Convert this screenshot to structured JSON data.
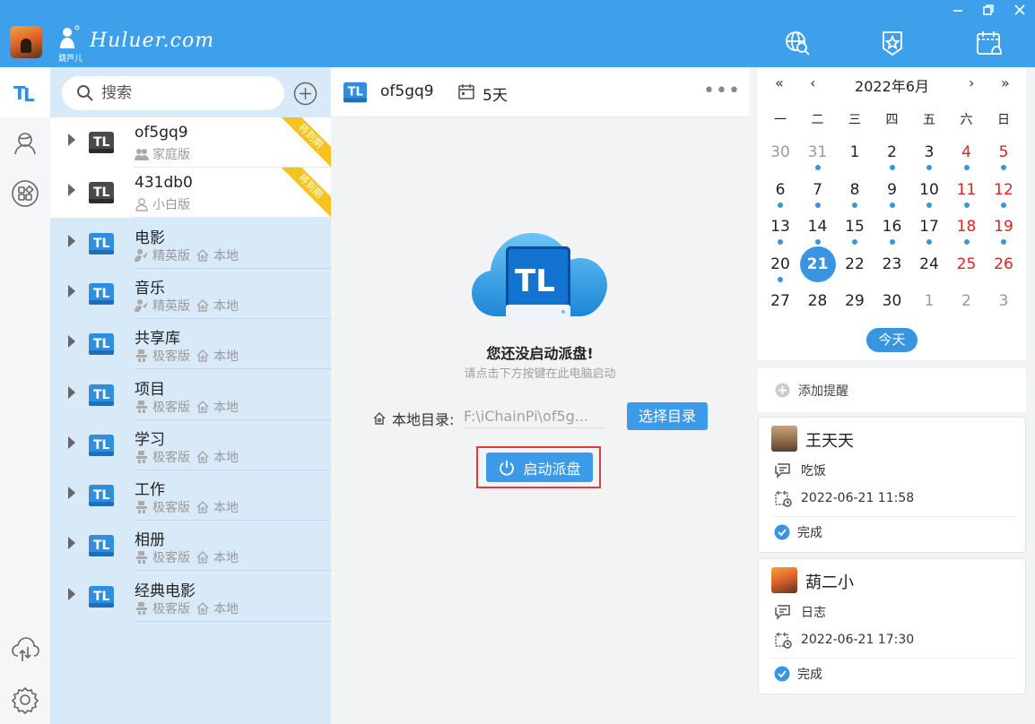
{
  "app": {
    "logo_subtext": "葫芦儿",
    "logo_text": "Huluer.com",
    "accent": "#3ea0ea"
  },
  "window_controls": [
    "minimize-icon",
    "restore-icon",
    "close-icon"
  ],
  "top_icons": [
    "web-search-icon",
    "favorites-badge-icon",
    "calendar-bell-icon"
  ],
  "left_rail": [
    "pan-app-icon",
    "contacts-icon",
    "apps-icon",
    "cloud-transfer-icon",
    "settings-icon"
  ],
  "search": {
    "placeholder": "搜索"
  },
  "drives": [
    {
      "name": "of5gq9",
      "edition": "家庭版",
      "location": "",
      "ribbon": "将到期",
      "style": "dark"
    },
    {
      "name": "431db0",
      "edition": "小白版",
      "location": "",
      "ribbon": "将到期",
      "style": "dark"
    },
    {
      "name": "电影",
      "edition": "精英版",
      "location": "本地",
      "ribbon": "",
      "style": "blue"
    },
    {
      "name": "音乐",
      "edition": "精英版",
      "location": "本地",
      "ribbon": "",
      "style": "blue"
    },
    {
      "name": "共享库",
      "edition": "极客版",
      "location": "本地",
      "ribbon": "",
      "style": "blue"
    },
    {
      "name": "项目",
      "edition": "极客版",
      "location": "本地",
      "ribbon": "",
      "style": "blue"
    },
    {
      "name": "学习",
      "edition": "极客版",
      "location": "本地",
      "ribbon": "",
      "style": "blue"
    },
    {
      "name": "工作",
      "edition": "极客版",
      "location": "本地",
      "ribbon": "",
      "style": "blue"
    },
    {
      "name": "相册",
      "edition": "极客版",
      "location": "本地",
      "ribbon": "",
      "style": "blue"
    },
    {
      "name": "经典电影",
      "edition": "极客版",
      "location": "本地",
      "ribbon": "",
      "style": "blue"
    }
  ],
  "main": {
    "drive_name": "of5gq9",
    "days_left": "5天",
    "more": "•••",
    "title": "您还没启动派盘!",
    "subtitle": "请点击下方按键在此电脑启动",
    "local_dir_label": "本地目录:",
    "local_dir_value": "F:\\iChainPi\\of5g...",
    "choose_button": "选择目录",
    "start_button": "启动派盘"
  },
  "calendar": {
    "title": "2022年6月",
    "nav_prev_year": "«",
    "nav_prev_month": "‹",
    "nav_next_month": "›",
    "nav_next_year": "»",
    "weekdays": [
      "一",
      "二",
      "三",
      "四",
      "五",
      "六",
      "日"
    ],
    "days": [
      {
        "d": "30",
        "t": "grey",
        "dot": false
      },
      {
        "d": "31",
        "t": "grey",
        "dot": true
      },
      {
        "d": "1",
        "t": "",
        "dot": false
      },
      {
        "d": "2",
        "t": "",
        "dot": true
      },
      {
        "d": "3",
        "t": "",
        "dot": true
      },
      {
        "d": "4",
        "t": "red",
        "dot": true
      },
      {
        "d": "5",
        "t": "red",
        "dot": true
      },
      {
        "d": "6",
        "t": "",
        "dot": true
      },
      {
        "d": "7",
        "t": "",
        "dot": true
      },
      {
        "d": "8",
        "t": "",
        "dot": true
      },
      {
        "d": "9",
        "t": "",
        "dot": true
      },
      {
        "d": "10",
        "t": "",
        "dot": true
      },
      {
        "d": "11",
        "t": "red",
        "dot": true
      },
      {
        "d": "12",
        "t": "red",
        "dot": true
      },
      {
        "d": "13",
        "t": "",
        "dot": true
      },
      {
        "d": "14",
        "t": "",
        "dot": true
      },
      {
        "d": "15",
        "t": "",
        "dot": true
      },
      {
        "d": "16",
        "t": "",
        "dot": true
      },
      {
        "d": "17",
        "t": "",
        "dot": true
      },
      {
        "d": "18",
        "t": "red",
        "dot": true
      },
      {
        "d": "19",
        "t": "red",
        "dot": true
      },
      {
        "d": "20",
        "t": "",
        "dot": true
      },
      {
        "d": "21",
        "t": "today",
        "dot": false
      },
      {
        "d": "22",
        "t": "",
        "dot": false
      },
      {
        "d": "23",
        "t": "",
        "dot": false
      },
      {
        "d": "24",
        "t": "",
        "dot": false
      },
      {
        "d": "25",
        "t": "red",
        "dot": false
      },
      {
        "d": "26",
        "t": "red",
        "dot": false
      },
      {
        "d": "27",
        "t": "",
        "dot": false
      },
      {
        "d": "28",
        "t": "",
        "dot": false
      },
      {
        "d": "29",
        "t": "",
        "dot": false
      },
      {
        "d": "30",
        "t": "",
        "dot": false
      },
      {
        "d": "1",
        "t": "grey",
        "dot": false
      },
      {
        "d": "2",
        "t": "grey",
        "dot": false
      },
      {
        "d": "3",
        "t": "grey",
        "dot": false
      }
    ],
    "today_button": "今天"
  },
  "reminders": {
    "add_label": "添加提醒",
    "items": [
      {
        "user": "王天天",
        "content": "吃饭",
        "datetime": "2022-06-21 11:58",
        "status": "完成"
      },
      {
        "user": "葫二小",
        "content": "日志",
        "datetime": "2022-06-21 17:30",
        "status": "完成"
      }
    ]
  }
}
